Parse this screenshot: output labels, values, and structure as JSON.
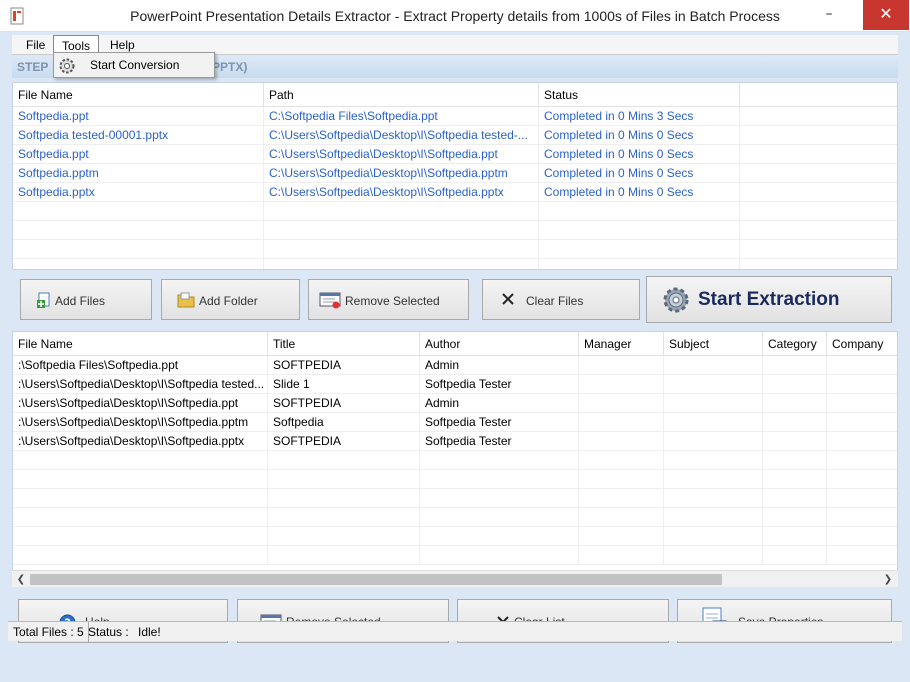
{
  "window": {
    "title": "PowerPoint Presentation Details Extractor - Extract Property details from 1000s of Files in Batch Process",
    "minimize": "–",
    "close": "✕"
  },
  "menu": {
    "items": [
      "File",
      "Tools",
      "Help"
    ],
    "dropdown_item": "Start Conversion"
  },
  "step": {
    "label": "STEP",
    "suffix": "PPTX)"
  },
  "files_table": {
    "headers": [
      "File Name",
      "Path",
      "Status"
    ],
    "rows": [
      [
        "Softpedia.ppt",
        "C:\\Softpedia Files\\Softpedia.ppt",
        "Completed in 0 Mins 3 Secs"
      ],
      [
        "Softpedia tested-00001.pptx",
        "C:\\Users\\Softpedia\\Desktop\\I\\Softpedia tested-...",
        "Completed in 0 Mins 0 Secs"
      ],
      [
        "Softpedia.ppt",
        "C:\\Users\\Softpedia\\Desktop\\I\\Softpedia.ppt",
        "Completed in 0 Mins 0 Secs"
      ],
      [
        "Softpedia.pptm",
        "C:\\Users\\Softpedia\\Desktop\\I\\Softpedia.pptm",
        "Completed in 0 Mins 0 Secs"
      ],
      [
        "Softpedia.pptx",
        "C:\\Users\\Softpedia\\Desktop\\I\\Softpedia.pptx",
        "Completed in 0 Mins 0 Secs"
      ]
    ]
  },
  "buttons_top": {
    "add_files": "Add Files",
    "add_folder": "Add Folder",
    "remove_selected": "Remove Selected",
    "clear_files": "Clear Files",
    "start_extraction": "Start Extraction"
  },
  "props_table": {
    "headers": [
      "File Name",
      "Title",
      "Author",
      "Manager",
      "Subject",
      "Category",
      "Company"
    ],
    "rows": [
      [
        ":\\Softpedia Files\\Softpedia.ppt",
        "SOFTPEDIA",
        "Admin",
        "",
        "",
        "",
        ""
      ],
      [
        ":\\Users\\Softpedia\\Desktop\\I\\Softpedia tested...",
        "Slide 1",
        "Softpedia Tester",
        "",
        "",
        "",
        ""
      ],
      [
        ":\\Users\\Softpedia\\Desktop\\I\\Softpedia.ppt",
        "SOFTPEDIA",
        "Admin",
        "",
        "",
        "",
        ""
      ],
      [
        ":\\Users\\Softpedia\\Desktop\\I\\Softpedia.pptm",
        "Softpedia",
        "Softpedia Tester",
        "",
        "",
        "",
        ""
      ],
      [
        ":\\Users\\Softpedia\\Desktop\\I\\Softpedia.pptx",
        "SOFTPEDIA",
        "Softpedia Tester",
        "",
        "",
        "",
        ""
      ]
    ]
  },
  "buttons_bottom": {
    "help": "Help",
    "remove_selected": "Remove Selected",
    "clear_list": "Clear List",
    "save_properties": "Save Properties"
  },
  "status": {
    "total_files": "Total Files : 5",
    "status_label": "Status :",
    "status_value": "Idle!"
  },
  "colors": {
    "link_blue": "#2b62c8",
    "frame_blue": "#dbe7f5",
    "close_red": "#c7372f",
    "start_text": "#1b2a5c"
  },
  "icons": [
    "powerpoint-app-icon",
    "gear-icon",
    "add-files-icon",
    "folder-icon",
    "remove-icon",
    "clear-x-icon",
    "help-icon",
    "save-icon"
  ]
}
